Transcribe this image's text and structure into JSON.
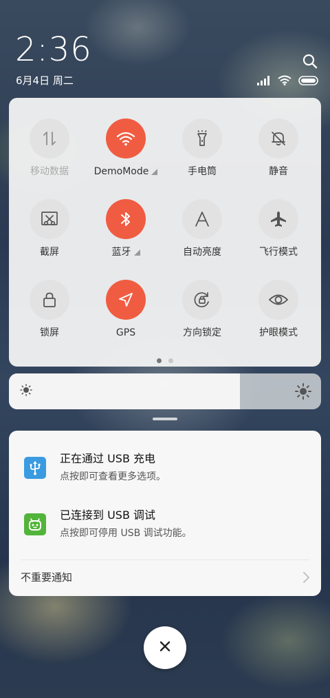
{
  "status": {
    "time": "2:36",
    "date": "6月4日 周二",
    "icons": [
      "search-icon",
      "signal-icon",
      "wifi-icon",
      "battery-icon"
    ]
  },
  "tiles": [
    {
      "label": "移动数据",
      "icon": "mobile-data-icon",
      "active": false,
      "dim": true
    },
    {
      "label": "DemoMode",
      "icon": "wifi-icon",
      "active": true,
      "more": true
    },
    {
      "label": "手电筒",
      "icon": "flashlight-icon",
      "active": false
    },
    {
      "label": "静音",
      "icon": "mute-bell-icon",
      "active": false
    },
    {
      "label": "截屏",
      "icon": "screenshot-icon",
      "active": false
    },
    {
      "label": "蓝牙",
      "icon": "bluetooth-icon",
      "active": true,
      "more": true
    },
    {
      "label": "自动亮度",
      "icon": "auto-brightness-icon",
      "active": false
    },
    {
      "label": "飞行模式",
      "icon": "airplane-icon",
      "active": false
    },
    {
      "label": "锁屏",
      "icon": "lock-icon",
      "active": false
    },
    {
      "label": "GPS",
      "icon": "gps-icon",
      "active": true
    },
    {
      "label": "方向锁定",
      "icon": "rotation-lock-icon",
      "active": false
    },
    {
      "label": "护眼模式",
      "icon": "eye-icon",
      "active": false
    }
  ],
  "pager": {
    "pages": 2,
    "current": 1
  },
  "brightness": {
    "level": 0.74
  },
  "notifications": [
    {
      "title": "正在通过 USB 充电",
      "subtitle": "点按即可查看更多选项。",
      "icon": "usb-icon",
      "color": "#3a9be0"
    },
    {
      "title": "已连接到 USB 调试",
      "subtitle": "点按即可停用 USB 调试功能。",
      "icon": "android-icon",
      "color": "#52b43a"
    }
  ],
  "footer": {
    "label": "不重要通知"
  },
  "colors": {
    "accent": "#f05c42",
    "tile_off": "#e2e2e2"
  }
}
